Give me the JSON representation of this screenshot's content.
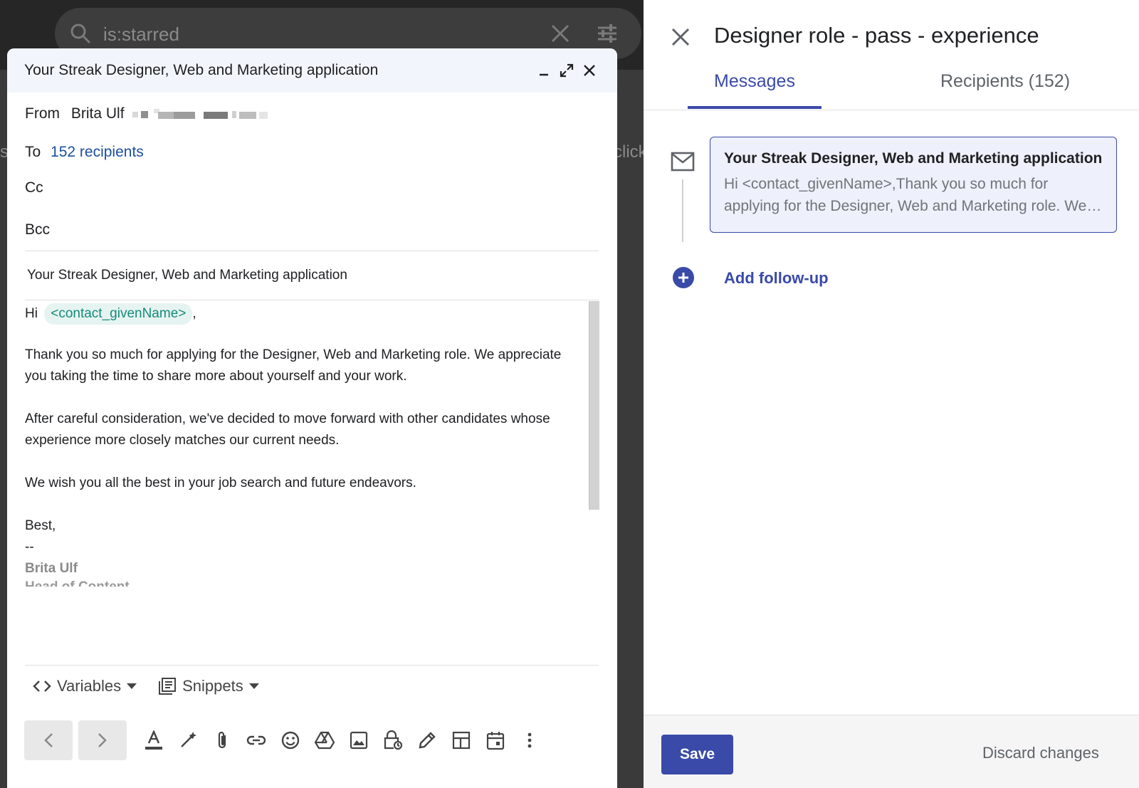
{
  "background": {
    "search_query": "is:starred",
    "partial_text_right": "click",
    "partial_text_left": "s"
  },
  "compose": {
    "title": "Your Streak Designer, Web and Marketing application",
    "from_label": "From",
    "from_name": "Brita Ulf",
    "to_label": "To",
    "to_value": "152 recipients",
    "cc_label": "Cc",
    "bcc_label": "Bcc",
    "subject": "Your Streak Designer, Web and Marketing application",
    "body": {
      "greeting_prefix": "Hi",
      "variable_chip": "<contact_givenName>",
      "greeting_suffix": ",",
      "paragraph_1": "Thank you so much for applying for the Designer, Web and Marketing role. We appreciate you taking the time to share more about yourself and your work.",
      "paragraph_2": "After careful consideration, we've decided to move forward with other candidates whose experience more closely matches our current needs.",
      "paragraph_3": "We wish you all the best in your job search and future endeavors.",
      "closing": "Best,",
      "sig_dash": "--",
      "sig_name": "Brita Ulf",
      "sig_cut": "Head of Content"
    },
    "toolbar": {
      "variables_label": "Variables",
      "snippets_label": "Snippets"
    }
  },
  "panel": {
    "title": "Designer role - pass - experience",
    "tabs": [
      {
        "label": "Messages"
      },
      {
        "label": "Recipients (152)"
      }
    ],
    "message_card": {
      "title": "Your Streak Designer, Web and Marketing application",
      "preview": "Hi <contact_givenName>,Thank you so much for applying for the Designer, Web and Marketing role. We appreciate you taking the time"
    },
    "add_followup": "Add follow-up",
    "save_label": "Save",
    "discard_label": "Discard changes"
  },
  "colors": {
    "accent": "#3a4aa8",
    "variable_chip_bg": "#e6f4f1",
    "variable_chip_text": "#168a7a",
    "link": "#1a4fa0"
  }
}
